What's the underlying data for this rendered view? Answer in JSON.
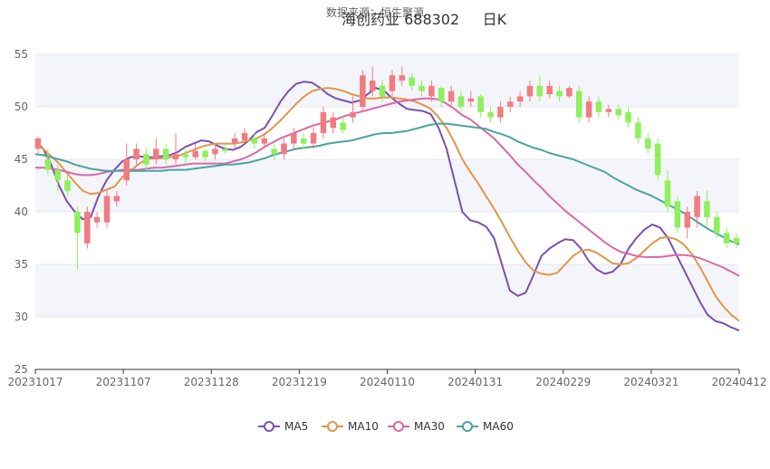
{
  "chart_data": {
    "type": "candlestick",
    "title": "海创药业 688302     日K",
    "subtitle": "数据来源：恒生聚源",
    "ylim": [
      25,
      55
    ],
    "y_ticks": [
      25,
      30,
      35,
      40,
      45,
      50,
      55
    ],
    "x_tick_labels": [
      "20231017",
      "20231107",
      "20231128",
      "20231219",
      "20240110",
      "20240131",
      "20240229",
      "20240321",
      "20240412"
    ],
    "grid": "horizontal bands",
    "legend_position": "bottom",
    "colors": {
      "up": "#f07c82",
      "down": "#8ef05a",
      "MA5": "#7b4fb0",
      "MA10": "#e0964a",
      "MA30": "#d868a8",
      "MA60": "#4aa3a0"
    },
    "series": [
      {
        "name": "MA5",
        "values": [
          46.8,
          46.0,
          44.5,
          42.5,
          41.0,
          40.0,
          39.3,
          39.5,
          41.5,
          43.0,
          44.0,
          44.8,
          45.2,
          45.3,
          45.2,
          45.2,
          45.3,
          45.4,
          45.7,
          46.2,
          46.5,
          46.8,
          46.7,
          46.3,
          46.0,
          45.9,
          46.2,
          46.8,
          47.6,
          48.0,
          49.2,
          50.5,
          51.5,
          52.2,
          52.4,
          52.3,
          51.8,
          51.2,
          50.8,
          50.6,
          50.4,
          50.6,
          51.2,
          51.8,
          51.6,
          50.9,
          50.3,
          49.8,
          49.7,
          49.6,
          49.3,
          48.0,
          46.0,
          43.0,
          40.0,
          39.2,
          39.0,
          38.6,
          37.5,
          35.0,
          32.5,
          32.0,
          32.3,
          34.0,
          35.8,
          36.5,
          37.0,
          37.4,
          37.3,
          36.5,
          35.3,
          34.5,
          34.1,
          34.3,
          35.0,
          36.5,
          37.5,
          38.3,
          38.8,
          38.5,
          37.5,
          36.0,
          34.5,
          33.0,
          31.5,
          30.2,
          29.6,
          29.4,
          29.0,
          28.7
        ]
      },
      {
        "name": "MA10",
        "values": [
          46.5,
          46.0,
          45.3,
          44.6,
          43.7,
          42.8,
          42.0,
          41.7,
          41.8,
          42.1,
          42.4,
          43.3,
          43.9,
          44.5,
          45.0,
          45.1,
          45.1,
          45.2,
          45.3,
          45.6,
          45.9,
          46.2,
          46.4,
          46.5,
          46.5,
          46.5,
          46.6,
          46.8,
          47.0,
          47.4,
          48.0,
          48.7,
          49.5,
          50.3,
          51.0,
          51.5,
          51.7,
          51.8,
          51.7,
          51.5,
          51.2,
          51.0,
          50.8,
          50.8,
          50.9,
          50.9,
          50.8,
          50.7,
          50.5,
          50.2,
          49.8,
          49.0,
          48.0,
          46.6,
          45.0,
          43.8,
          42.7,
          41.5,
          40.3,
          39.0,
          37.6,
          36.3,
          35.2,
          34.4,
          34.1,
          34.0,
          34.2,
          35.0,
          35.8,
          36.3,
          36.4,
          36.1,
          35.6,
          35.1,
          35.0,
          35.1,
          35.6,
          36.3,
          37.0,
          37.5,
          37.6,
          37.4,
          36.9,
          36.0,
          34.8,
          33.4,
          32.0,
          31.0,
          30.2,
          29.6
        ]
      },
      {
        "name": "MA30",
        "values": [
          44.2,
          44.2,
          44.1,
          44.0,
          43.8,
          43.6,
          43.5,
          43.5,
          43.6,
          43.8,
          43.9,
          44.0,
          44.0,
          44.0,
          44.1,
          44.2,
          44.2,
          44.3,
          44.4,
          44.5,
          44.6,
          44.6,
          44.6,
          44.6,
          44.6,
          44.8,
          45.0,
          45.3,
          45.7,
          46.2,
          46.6,
          47.0,
          47.3,
          47.6,
          47.9,
          48.2,
          48.4,
          48.6,
          48.8,
          49.1,
          49.3,
          49.5,
          49.7,
          49.9,
          50.1,
          50.3,
          50.5,
          50.6,
          50.7,
          50.8,
          50.8,
          50.7,
          50.3,
          49.8,
          49.2,
          48.8,
          48.2,
          47.6,
          47.0,
          46.2,
          45.4,
          44.5,
          43.8,
          43.0,
          42.3,
          41.5,
          40.8,
          40.1,
          39.5,
          38.9,
          38.3,
          37.7,
          37.1,
          36.6,
          36.2,
          36.0,
          35.8,
          35.7,
          35.7,
          35.7,
          35.8,
          35.9,
          35.9,
          35.8,
          35.6,
          35.3,
          35.0,
          34.7,
          34.3,
          33.9
        ]
      },
      {
        "name": "MA60",
        "values": [
          45.5,
          45.4,
          45.2,
          45.0,
          44.8,
          44.5,
          44.3,
          44.1,
          44.0,
          43.9,
          43.9,
          43.9,
          43.9,
          43.9,
          43.9,
          43.9,
          43.9,
          44.0,
          44.0,
          44.0,
          44.1,
          44.2,
          44.3,
          44.4,
          44.5,
          44.5,
          44.6,
          44.7,
          44.9,
          45.1,
          45.4,
          45.6,
          45.8,
          46.0,
          46.1,
          46.2,
          46.3,
          46.5,
          46.6,
          46.7,
          46.8,
          47.0,
          47.2,
          47.4,
          47.5,
          47.5,
          47.6,
          47.7,
          47.9,
          48.1,
          48.3,
          48.4,
          48.4,
          48.3,
          48.2,
          48.1,
          48.0,
          47.9,
          47.6,
          47.4,
          47.1,
          46.7,
          46.4,
          46.1,
          45.9,
          45.6,
          45.4,
          45.2,
          45.0,
          44.7,
          44.4,
          44.1,
          43.8,
          43.3,
          42.9,
          42.5,
          42.1,
          41.8,
          41.5,
          41.1,
          40.7,
          40.3,
          39.9,
          39.4,
          38.9,
          38.4,
          38.0,
          37.6,
          37.2,
          36.9
        ]
      }
    ],
    "candles": [
      {
        "o": 46.0,
        "c": 47.0,
        "h": 47.2,
        "l": 45.5
      },
      {
        "o": 45.0,
        "c": 44.0,
        "h": 46.0,
        "l": 43.5
      },
      {
        "o": 44.0,
        "c": 43.0,
        "h": 44.5,
        "l": 42.0
      },
      {
        "o": 43.0,
        "c": 42.0,
        "h": 43.5,
        "l": 41.5
      },
      {
        "o": 40.0,
        "c": 38.0,
        "h": 40.5,
        "l": 34.5
      },
      {
        "o": 37.0,
        "c": 40.0,
        "h": 40.5,
        "l": 36.5
      },
      {
        "o": 39.0,
        "c": 39.5,
        "h": 40.0,
        "l": 38.5
      },
      {
        "o": 39.0,
        "c": 41.5,
        "h": 42.0,
        "l": 38.5
      },
      {
        "o": 41.0,
        "c": 41.5,
        "h": 42.0,
        "l": 40.5
      },
      {
        "o": 43.0,
        "c": 45.0,
        "h": 46.5,
        "l": 42.5
      },
      {
        "o": 45.0,
        "c": 46.0,
        "h": 46.5,
        "l": 44.5
      },
      {
        "o": 45.5,
        "c": 44.5,
        "h": 46.0,
        "l": 44.0
      },
      {
        "o": 45.0,
        "c": 46.0,
        "h": 47.0,
        "l": 44.5
      },
      {
        "o": 46.0,
        "c": 45.0,
        "h": 46.5,
        "l": 44.5
      },
      {
        "o": 45.0,
        "c": 45.5,
        "h": 47.5,
        "l": 44.5
      },
      {
        "o": 45.5,
        "c": 45.2,
        "h": 46.0,
        "l": 44.5
      },
      {
        "o": 45.2,
        "c": 45.8,
        "h": 46.5,
        "l": 45.0
      },
      {
        "o": 45.8,
        "c": 45.2,
        "h": 46.0,
        "l": 44.8
      },
      {
        "o": 45.5,
        "c": 46.0,
        "h": 46.5,
        "l": 45.0
      },
      {
        "o": 46.0,
        "c": 45.8,
        "h": 46.5,
        "l": 45.5
      },
      {
        "o": 46.5,
        "c": 47.0,
        "h": 47.5,
        "l": 46.0
      },
      {
        "o": 46.8,
        "c": 47.5,
        "h": 48.0,
        "l": 46.5
      },
      {
        "o": 47.0,
        "c": 46.5,
        "h": 47.5,
        "l": 46.0
      },
      {
        "o": 46.5,
        "c": 47.0,
        "h": 47.5,
        "l": 46.0
      },
      {
        "o": 46.0,
        "c": 45.5,
        "h": 46.5,
        "l": 45.0
      },
      {
        "o": 45.5,
        "c": 46.5,
        "h": 47.0,
        "l": 45.0
      },
      {
        "o": 46.5,
        "c": 47.5,
        "h": 48.0,
        "l": 46.0
      },
      {
        "o": 47.0,
        "c": 46.5,
        "h": 47.5,
        "l": 46.0
      },
      {
        "o": 46.5,
        "c": 47.5,
        "h": 48.0,
        "l": 46.0
      },
      {
        "o": 47.5,
        "c": 49.5,
        "h": 50.0,
        "l": 47.0
      },
      {
        "o": 48.0,
        "c": 49.0,
        "h": 49.5,
        "l": 47.5
      },
      {
        "o": 48.5,
        "c": 47.8,
        "h": 49.0,
        "l": 47.5
      },
      {
        "o": 49.0,
        "c": 49.5,
        "h": 51.0,
        "l": 48.5
      },
      {
        "o": 50.0,
        "c": 53.0,
        "h": 53.5,
        "l": 49.5
      },
      {
        "o": 51.5,
        "c": 52.5,
        "h": 53.8,
        "l": 51.0
      },
      {
        "o": 52.0,
        "c": 51.0,
        "h": 52.5,
        "l": 50.5
      },
      {
        "o": 51.5,
        "c": 53.0,
        "h": 53.5,
        "l": 51.0
      },
      {
        "o": 52.5,
        "c": 53.0,
        "h": 53.8,
        "l": 52.0
      },
      {
        "o": 52.8,
        "c": 52.0,
        "h": 53.2,
        "l": 51.5
      },
      {
        "o": 52.0,
        "c": 51.5,
        "h": 52.5,
        "l": 51.0
      },
      {
        "o": 51.0,
        "c": 52.0,
        "h": 52.5,
        "l": 50.5
      },
      {
        "o": 51.8,
        "c": 50.5,
        "h": 52.0,
        "l": 50.0
      },
      {
        "o": 50.5,
        "c": 51.5,
        "h": 52.0,
        "l": 50.0
      },
      {
        "o": 51.0,
        "c": 50.0,
        "h": 51.5,
        "l": 49.5
      },
      {
        "o": 50.5,
        "c": 50.8,
        "h": 51.5,
        "l": 50.0
      },
      {
        "o": 51.0,
        "c": 49.5,
        "h": 51.2,
        "l": 49.0
      },
      {
        "o": 49.5,
        "c": 49.0,
        "h": 50.0,
        "l": 48.5
      },
      {
        "o": 49.0,
        "c": 50.0,
        "h": 50.5,
        "l": 48.5
      },
      {
        "o": 50.0,
        "c": 50.5,
        "h": 51.0,
        "l": 49.5
      },
      {
        "o": 50.5,
        "c": 51.0,
        "h": 51.5,
        "l": 50.0
      },
      {
        "o": 51.0,
        "c": 52.0,
        "h": 52.5,
        "l": 50.5
      },
      {
        "o": 52.0,
        "c": 51.0,
        "h": 53.0,
        "l": 50.5
      },
      {
        "o": 51.2,
        "c": 52.0,
        "h": 52.5,
        "l": 50.8
      },
      {
        "o": 51.5,
        "c": 51.0,
        "h": 52.0,
        "l": 50.5
      },
      {
        "o": 51.0,
        "c": 51.8,
        "h": 52.0,
        "l": 50.8
      },
      {
        "o": 51.5,
        "c": 49.0,
        "h": 52.0,
        "l": 48.5
      },
      {
        "o": 49.0,
        "c": 50.5,
        "h": 51.0,
        "l": 48.5
      },
      {
        "o": 50.5,
        "c": 49.5,
        "h": 51.0,
        "l": 49.0
      },
      {
        "o": 49.5,
        "c": 49.8,
        "h": 50.2,
        "l": 49.0
      },
      {
        "o": 49.8,
        "c": 49.2,
        "h": 50.2,
        "l": 48.8
      },
      {
        "o": 49.5,
        "c": 48.5,
        "h": 50.0,
        "l": 48.0
      },
      {
        "o": 48.5,
        "c": 47.0,
        "h": 49.0,
        "l": 46.5
      },
      {
        "o": 47.0,
        "c": 46.0,
        "h": 47.5,
        "l": 45.5
      },
      {
        "o": 46.5,
        "c": 43.5,
        "h": 47.0,
        "l": 43.0
      },
      {
        "o": 43.0,
        "c": 40.5,
        "h": 44.0,
        "l": 40.0
      },
      {
        "o": 41.0,
        "c": 38.5,
        "h": 41.5,
        "l": 38.0
      },
      {
        "o": 38.5,
        "c": 40.0,
        "h": 40.5,
        "l": 37.5
      },
      {
        "o": 39.5,
        "c": 41.5,
        "h": 42.0,
        "l": 38.5
      },
      {
        "o": 41.0,
        "c": 39.5,
        "h": 42.0,
        "l": 38.5
      },
      {
        "o": 39.5,
        "c": 38.0,
        "h": 40.0,
        "l": 37.5
      },
      {
        "o": 38.0,
        "c": 37.0,
        "h": 38.5,
        "l": 36.5
      },
      {
        "o": 37.5,
        "c": 37.0,
        "h": 38.0,
        "l": 36.5
      }
    ]
  },
  "legend": [
    {
      "label": "MA5",
      "color": "#7b4fb0"
    },
    {
      "label": "MA10",
      "color": "#e0964a"
    },
    {
      "label": "MA30",
      "color": "#d868a8"
    },
    {
      "label": "MA60",
      "color": "#4aa3a0"
    }
  ]
}
